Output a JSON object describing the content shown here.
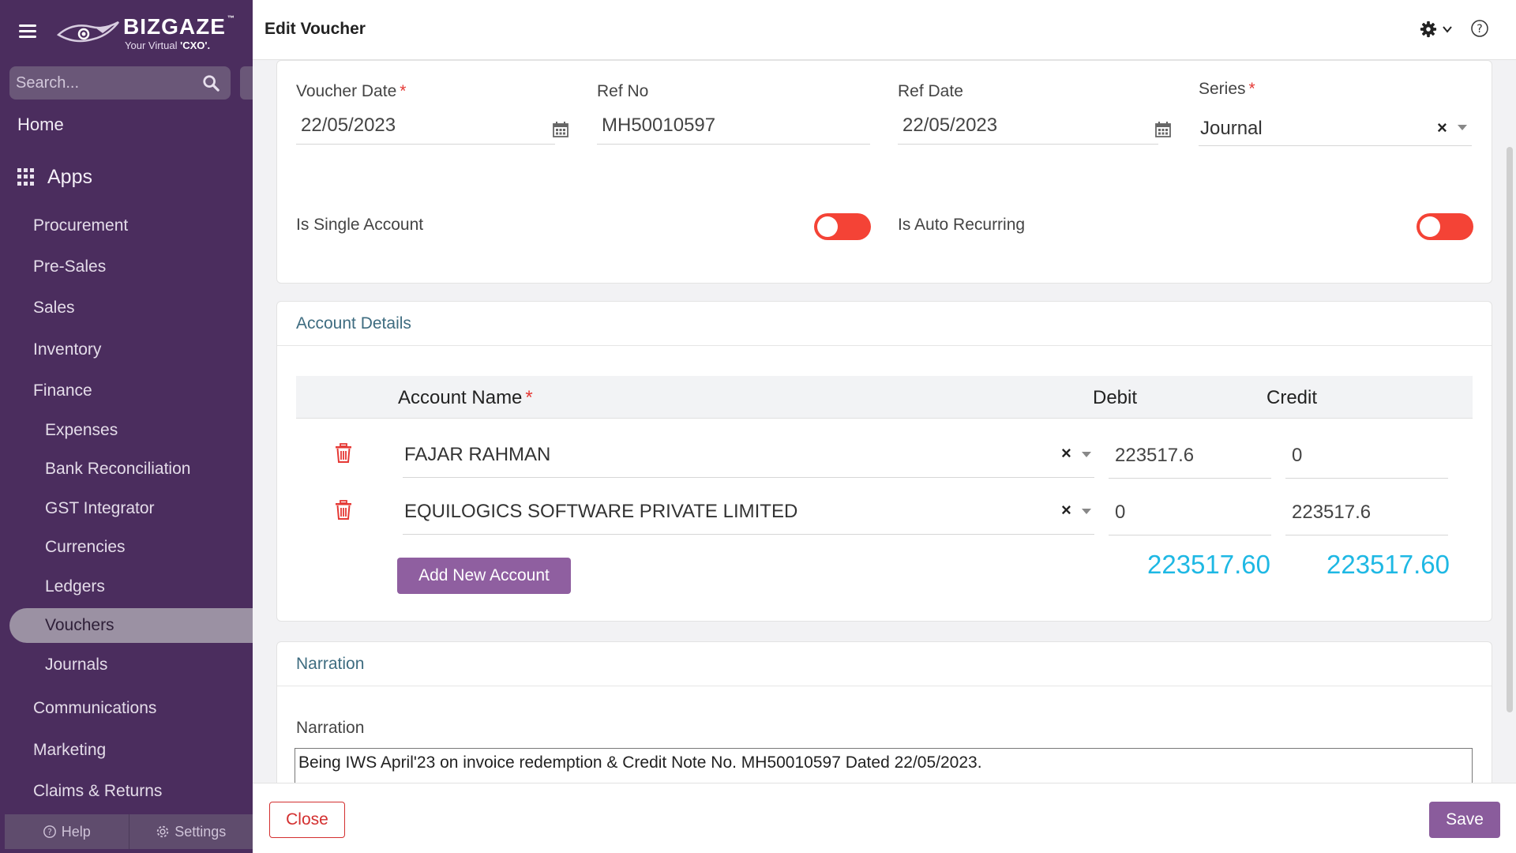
{
  "sidebar": {
    "logo": {
      "name": "BIZGAZE",
      "tm": "™",
      "tagline_pre": "Your Virtual ",
      "tagline_bold": "'CXO'."
    },
    "search_placeholder": "Search...",
    "home": "Home",
    "apps": "Apps",
    "items": [
      {
        "label": "Procurement",
        "level": 1
      },
      {
        "label": "Pre-Sales",
        "level": 1
      },
      {
        "label": "Sales",
        "level": 1
      },
      {
        "label": "Inventory",
        "level": 1
      },
      {
        "label": "Finance",
        "level": 1
      },
      {
        "label": "Expenses",
        "level": 2
      },
      {
        "label": "Bank Reconciliation",
        "level": 2
      },
      {
        "label": "GST Integrator",
        "level": 2
      },
      {
        "label": "Currencies",
        "level": 2
      },
      {
        "label": "Ledgers",
        "level": 2
      },
      {
        "label": "Vouchers",
        "level": 2,
        "active": true
      },
      {
        "label": "Journals",
        "level": 2
      },
      {
        "label": "Communications",
        "level": 1
      },
      {
        "label": "Marketing",
        "level": 1
      },
      {
        "label": "Claims & Returns",
        "level": 1
      }
    ],
    "bottom": {
      "help": "Help",
      "settings": "Settings"
    }
  },
  "header": {
    "title": "Edit Voucher",
    "icons": [
      "gear-icon",
      "chevron-down-icon",
      "help-icon"
    ]
  },
  "form": {
    "voucher_date": {
      "label": "Voucher Date",
      "value": "22/05/2023"
    },
    "ref_no": {
      "label": "Ref No",
      "value": "MH50010597"
    },
    "ref_date": {
      "label": "Ref Date",
      "value": "22/05/2023"
    },
    "series": {
      "label": "Series",
      "value": "Journal"
    },
    "is_single_account": {
      "label": "Is Single Account",
      "on": false
    },
    "is_auto_recurring": {
      "label": "Is Auto Recurring",
      "on": false
    },
    "required_mark": "*"
  },
  "account_details": {
    "title": "Account Details",
    "columns": {
      "account": "Account Name",
      "debit": "Debit",
      "credit": "Credit"
    },
    "rows": [
      {
        "account": "FAJAR RAHMAN",
        "debit": "223517.6",
        "credit": "0"
      },
      {
        "account": "EQUILOGICS SOFTWARE PRIVATE LIMITED",
        "debit": "0",
        "credit": "223517.6"
      }
    ],
    "add_button": "Add New Account",
    "total_debit": "223517.60",
    "total_credit": "223517.60"
  },
  "narration": {
    "title": "Narration",
    "label": "Narration",
    "value": "Being IWS April'23 on invoice redemption & Credit Note No. MH50010597 Dated 22/05/2023."
  },
  "footer": {
    "close": "Close",
    "save": "Save"
  },
  "colors": {
    "sidebar": "#4b2d5e",
    "accent": "#8f5fa0",
    "toggle_off": "#f44336",
    "total": "#1eb8e4",
    "danger": "#d32f2f"
  }
}
